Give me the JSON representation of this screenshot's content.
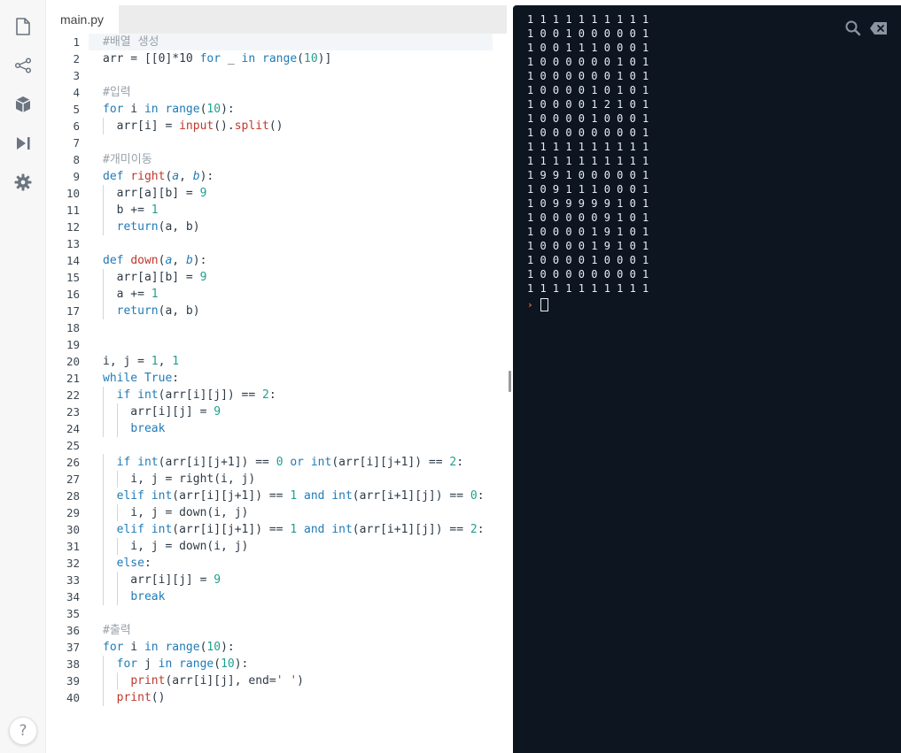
{
  "rail": {
    "icons": [
      "file-icon",
      "share-icon",
      "package-icon",
      "run-icon",
      "gear-icon"
    ],
    "help_label": "?"
  },
  "editor": {
    "tab_label": "main.py",
    "line_numbers": [
      "1",
      "2",
      "3",
      "4",
      "5",
      "6",
      "7",
      "8",
      "9",
      "10",
      "11",
      "12",
      "13",
      "14",
      "15",
      "16",
      "17",
      "18",
      "19",
      "20",
      "21",
      "22",
      "23",
      "24",
      "25",
      "26",
      "27",
      "28",
      "29",
      "30",
      "31",
      "32",
      "33",
      "34",
      "35",
      "36",
      "37",
      "38",
      "39",
      "40"
    ],
    "code_lines": [
      [
        [
          "c",
          "#배열 생성"
        ]
      ],
      [
        [
          "p",
          "arr = [[0]*10 "
        ],
        [
          "k",
          "for"
        ],
        [
          "p",
          " _ "
        ],
        [
          "k",
          "in"
        ],
        [
          "p",
          " "
        ],
        [
          "k",
          "range"
        ],
        [
          "p",
          "("
        ],
        [
          "n",
          "10"
        ],
        [
          "p",
          ")]"
        ]
      ],
      [],
      [
        [
          "c",
          "#입력"
        ]
      ],
      [
        [
          "k",
          "for"
        ],
        [
          "p",
          " i "
        ],
        [
          "k",
          "in"
        ],
        [
          "p",
          " "
        ],
        [
          "k",
          "range"
        ],
        [
          "p",
          "("
        ],
        [
          "n",
          "10"
        ],
        [
          "p",
          "):"
        ]
      ],
      [
        [
          "p",
          "  arr[i] = "
        ],
        [
          "f",
          "input"
        ],
        [
          "p",
          "()."
        ],
        [
          "f",
          "split"
        ],
        [
          "p",
          "()"
        ]
      ],
      [],
      [
        [
          "c",
          "#개미이동"
        ]
      ],
      [
        [
          "k",
          "def"
        ],
        [
          "p",
          " "
        ],
        [
          "f",
          "right"
        ],
        [
          "p",
          "("
        ],
        [
          "a",
          "a"
        ],
        [
          "p",
          ", "
        ],
        [
          "a",
          "b"
        ],
        [
          "p",
          "):"
        ]
      ],
      [
        [
          "p",
          "  arr[a][b] = "
        ],
        [
          "n",
          "9"
        ]
      ],
      [
        [
          "p",
          "  b += "
        ],
        [
          "n",
          "1"
        ]
      ],
      [
        [
          "p",
          "  "
        ],
        [
          "k",
          "return"
        ],
        [
          "p",
          "(a, b)"
        ]
      ],
      [],
      [
        [
          "k",
          "def"
        ],
        [
          "p",
          " "
        ],
        [
          "f",
          "down"
        ],
        [
          "p",
          "("
        ],
        [
          "a",
          "a"
        ],
        [
          "p",
          ", "
        ],
        [
          "a",
          "b"
        ],
        [
          "p",
          "):"
        ]
      ],
      [
        [
          "p",
          "  arr[a][b] = "
        ],
        [
          "n",
          "9"
        ]
      ],
      [
        [
          "p",
          "  a += "
        ],
        [
          "n",
          "1"
        ]
      ],
      [
        [
          "p",
          "  "
        ],
        [
          "k",
          "return"
        ],
        [
          "p",
          "(a, b)"
        ]
      ],
      [],
      [],
      [
        [
          "p",
          "i, j = "
        ],
        [
          "n",
          "1"
        ],
        [
          "p",
          ", "
        ],
        [
          "n",
          "1"
        ]
      ],
      [
        [
          "k",
          "while"
        ],
        [
          "p",
          " "
        ],
        [
          "k",
          "True"
        ],
        [
          "p",
          ":"
        ]
      ],
      [
        [
          "p",
          "  "
        ],
        [
          "k",
          "if"
        ],
        [
          "p",
          " "
        ],
        [
          "k",
          "int"
        ],
        [
          "p",
          "(arr[i][j]) == "
        ],
        [
          "n",
          "2"
        ],
        [
          "p",
          ":"
        ]
      ],
      [
        [
          "p",
          "    arr[i][j] = "
        ],
        [
          "n",
          "9"
        ]
      ],
      [
        [
          "p",
          "    "
        ],
        [
          "k",
          "break"
        ]
      ],
      [],
      [
        [
          "p",
          "  "
        ],
        [
          "k",
          "if"
        ],
        [
          "p",
          " "
        ],
        [
          "k",
          "int"
        ],
        [
          "p",
          "(arr[i][j+1]) == "
        ],
        [
          "n",
          "0"
        ],
        [
          "p",
          " "
        ],
        [
          "k",
          "or"
        ],
        [
          "p",
          " "
        ],
        [
          "k",
          "int"
        ],
        [
          "p",
          "(arr[i][j+1]) == "
        ],
        [
          "n",
          "2"
        ],
        [
          "p",
          ":"
        ]
      ],
      [
        [
          "p",
          "    i, j = right(i, j)"
        ]
      ],
      [
        [
          "p",
          "  "
        ],
        [
          "k",
          "elif"
        ],
        [
          "p",
          " "
        ],
        [
          "k",
          "int"
        ],
        [
          "p",
          "(arr[i][j+1]) == "
        ],
        [
          "n",
          "1"
        ],
        [
          "p",
          " "
        ],
        [
          "k",
          "and"
        ],
        [
          "p",
          " "
        ],
        [
          "k",
          "int"
        ],
        [
          "p",
          "(arr[i+1][j]) == "
        ],
        [
          "n",
          "0"
        ],
        [
          "p",
          ":"
        ]
      ],
      [
        [
          "p",
          "    i, j = down(i, j)"
        ]
      ],
      [
        [
          "p",
          "  "
        ],
        [
          "k",
          "elif"
        ],
        [
          "p",
          " "
        ],
        [
          "k",
          "int"
        ],
        [
          "p",
          "(arr[i][j+1]) == "
        ],
        [
          "n",
          "1"
        ],
        [
          "p",
          " "
        ],
        [
          "k",
          "and"
        ],
        [
          "p",
          " "
        ],
        [
          "k",
          "int"
        ],
        [
          "p",
          "(arr[i+1][j]) == "
        ],
        [
          "n",
          "2"
        ],
        [
          "p",
          ":"
        ]
      ],
      [
        [
          "p",
          "    i, j = down(i, j)"
        ]
      ],
      [
        [
          "p",
          "  "
        ],
        [
          "k",
          "else"
        ],
        [
          "p",
          ":"
        ]
      ],
      [
        [
          "p",
          "    arr[i][j] = "
        ],
        [
          "n",
          "9"
        ]
      ],
      [
        [
          "p",
          "    "
        ],
        [
          "k",
          "break"
        ]
      ],
      [],
      [
        [
          "c",
          "#출력"
        ]
      ],
      [
        [
          "k",
          "for"
        ],
        [
          "p",
          " i "
        ],
        [
          "k",
          "in"
        ],
        [
          "p",
          " "
        ],
        [
          "k",
          "range"
        ],
        [
          "p",
          "("
        ],
        [
          "n",
          "10"
        ],
        [
          "p",
          "):"
        ]
      ],
      [
        [
          "p",
          "  "
        ],
        [
          "k",
          "for"
        ],
        [
          "p",
          " j "
        ],
        [
          "k",
          "in"
        ],
        [
          "p",
          " "
        ],
        [
          "k",
          "range"
        ],
        [
          "p",
          "("
        ],
        [
          "n",
          "10"
        ],
        [
          "p",
          "):"
        ]
      ],
      [
        [
          "p",
          "    "
        ],
        [
          "f",
          "print"
        ],
        [
          "p",
          "(arr[i][j], end="
        ],
        [
          "s",
          "' '"
        ],
        [
          "p",
          ")"
        ]
      ],
      [
        [
          "p",
          "  "
        ],
        [
          "f",
          "print"
        ],
        [
          "p",
          "()"
        ]
      ]
    ]
  },
  "console": {
    "output_lines": [
      "1 1 1 1 1 1 1 1 1 1",
      "1 0 0 1 0 0 0 0 0 1",
      "1 0 0 1 1 1 0 0 0 1",
      "1 0 0 0 0 0 0 1 0 1",
      "1 0 0 0 0 0 0 1 0 1",
      "1 0 0 0 0 1 0 1 0 1",
      "1 0 0 0 0 1 2 1 0 1",
      "1 0 0 0 0 1 0 0 0 1",
      "1 0 0 0 0 0 0 0 0 1",
      "1 1 1 1 1 1 1 1 1 1",
      "1 1 1 1 1 1 1 1 1 1",
      "1 9 9 1 0 0 0 0 0 1",
      "1 0 9 1 1 1 0 0 0 1",
      "1 0 9 9 9 9 9 1 0 1",
      "1 0 0 0 0 0 9 1 0 1",
      "1 0 0 0 0 1 9 1 0 1",
      "1 0 0 0 0 1 9 1 0 1",
      "1 0 0 0 0 1 0 0 0 1",
      "1 0 0 0 0 0 0 0 0 1",
      "1 1 1 1 1 1 1 1 1 1"
    ],
    "prompt_symbol": "›",
    "icons": [
      "search-icon",
      "clear-console-icon"
    ]
  }
}
